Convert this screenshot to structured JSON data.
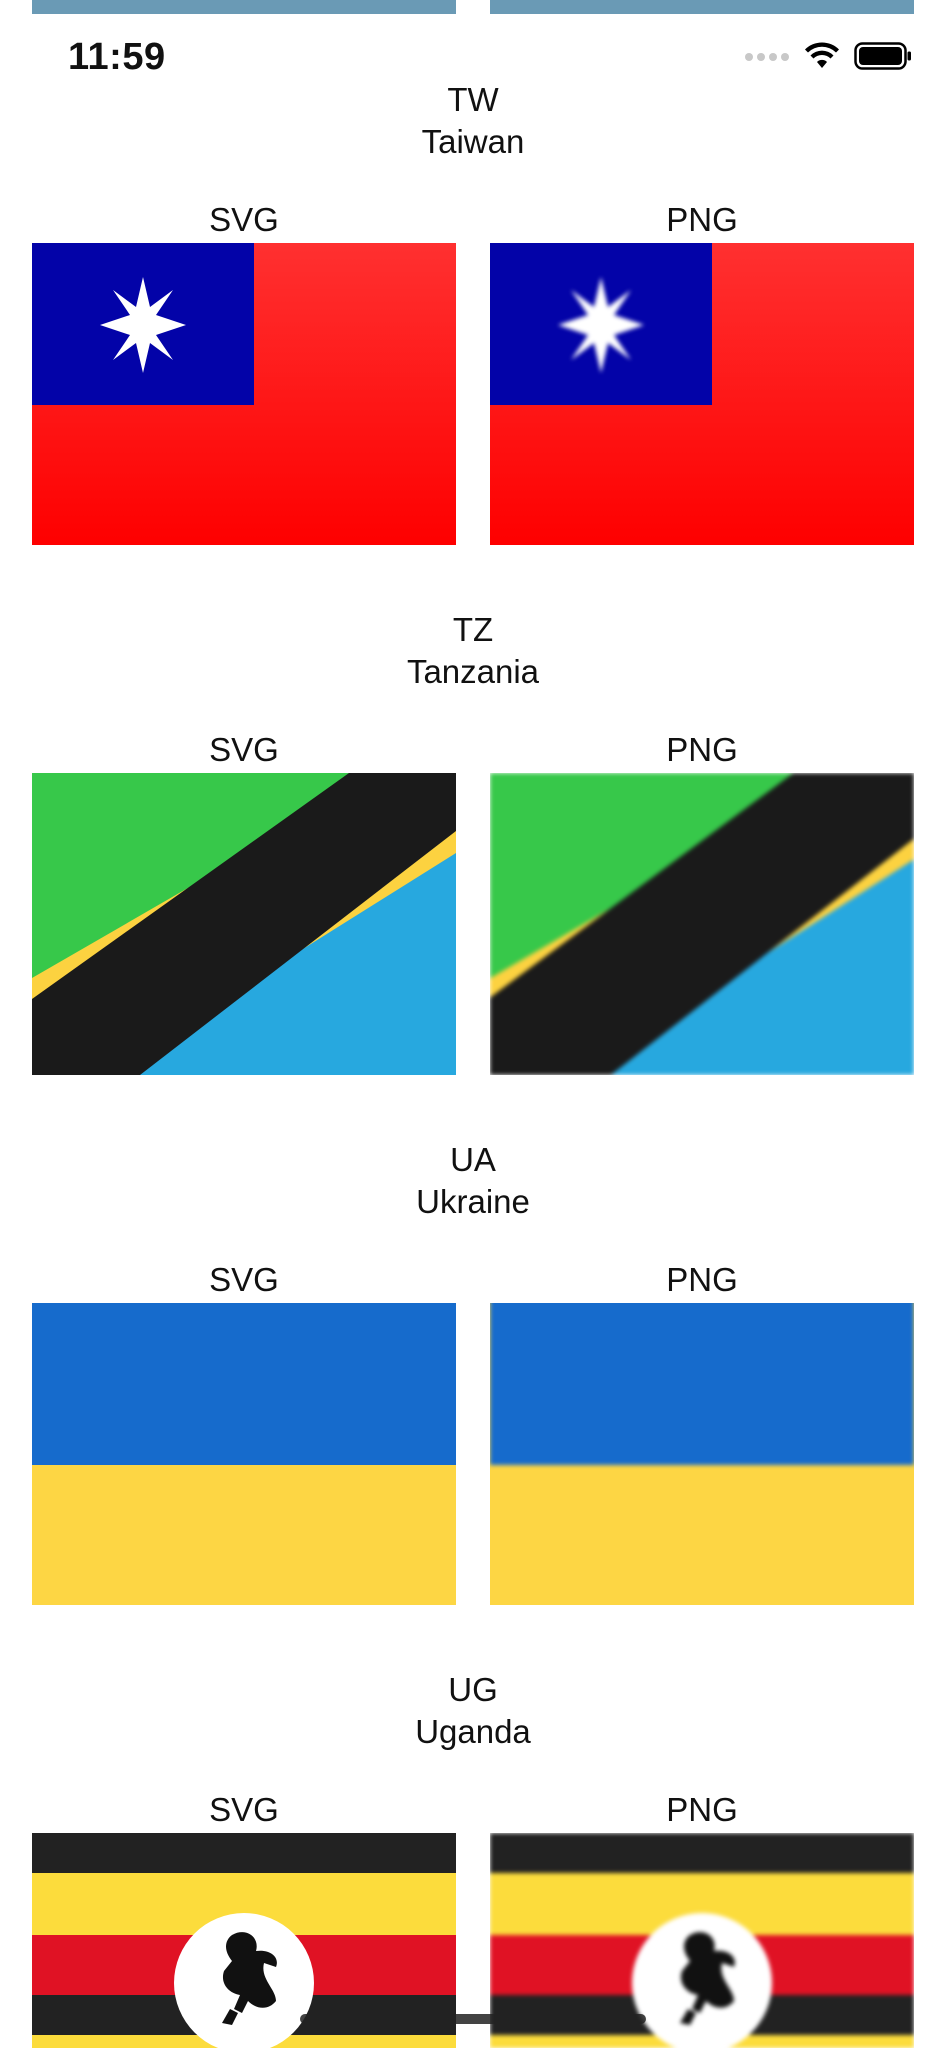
{
  "status_bar": {
    "time": "11:59",
    "icons": [
      "cellular-dots-icon",
      "wifi-icon",
      "battery-icon"
    ]
  },
  "column_labels": {
    "svg": "SVG",
    "png": "PNG"
  },
  "countries": [
    {
      "code": "TW",
      "name": "Taiwan",
      "colors": {
        "red": "#fe0000",
        "blue": "#000095",
        "white": "#ffffff"
      }
    },
    {
      "code": "TZ",
      "name": "Tanzania",
      "colors": {
        "green": "#1eb53a",
        "yellow": "#fcd116",
        "black": "#000000",
        "blue": "#00a3dd"
      }
    },
    {
      "code": "UA",
      "name": "Ukraine",
      "colors": {
        "blue": "#0057b7",
        "yellow": "#ffd700"
      }
    },
    {
      "code": "UG",
      "name": "Uganda",
      "colors": {
        "black": "#000000",
        "yellow": "#fcdc04",
        "red": "#d90000",
        "white": "#ffffff"
      }
    }
  ]
}
